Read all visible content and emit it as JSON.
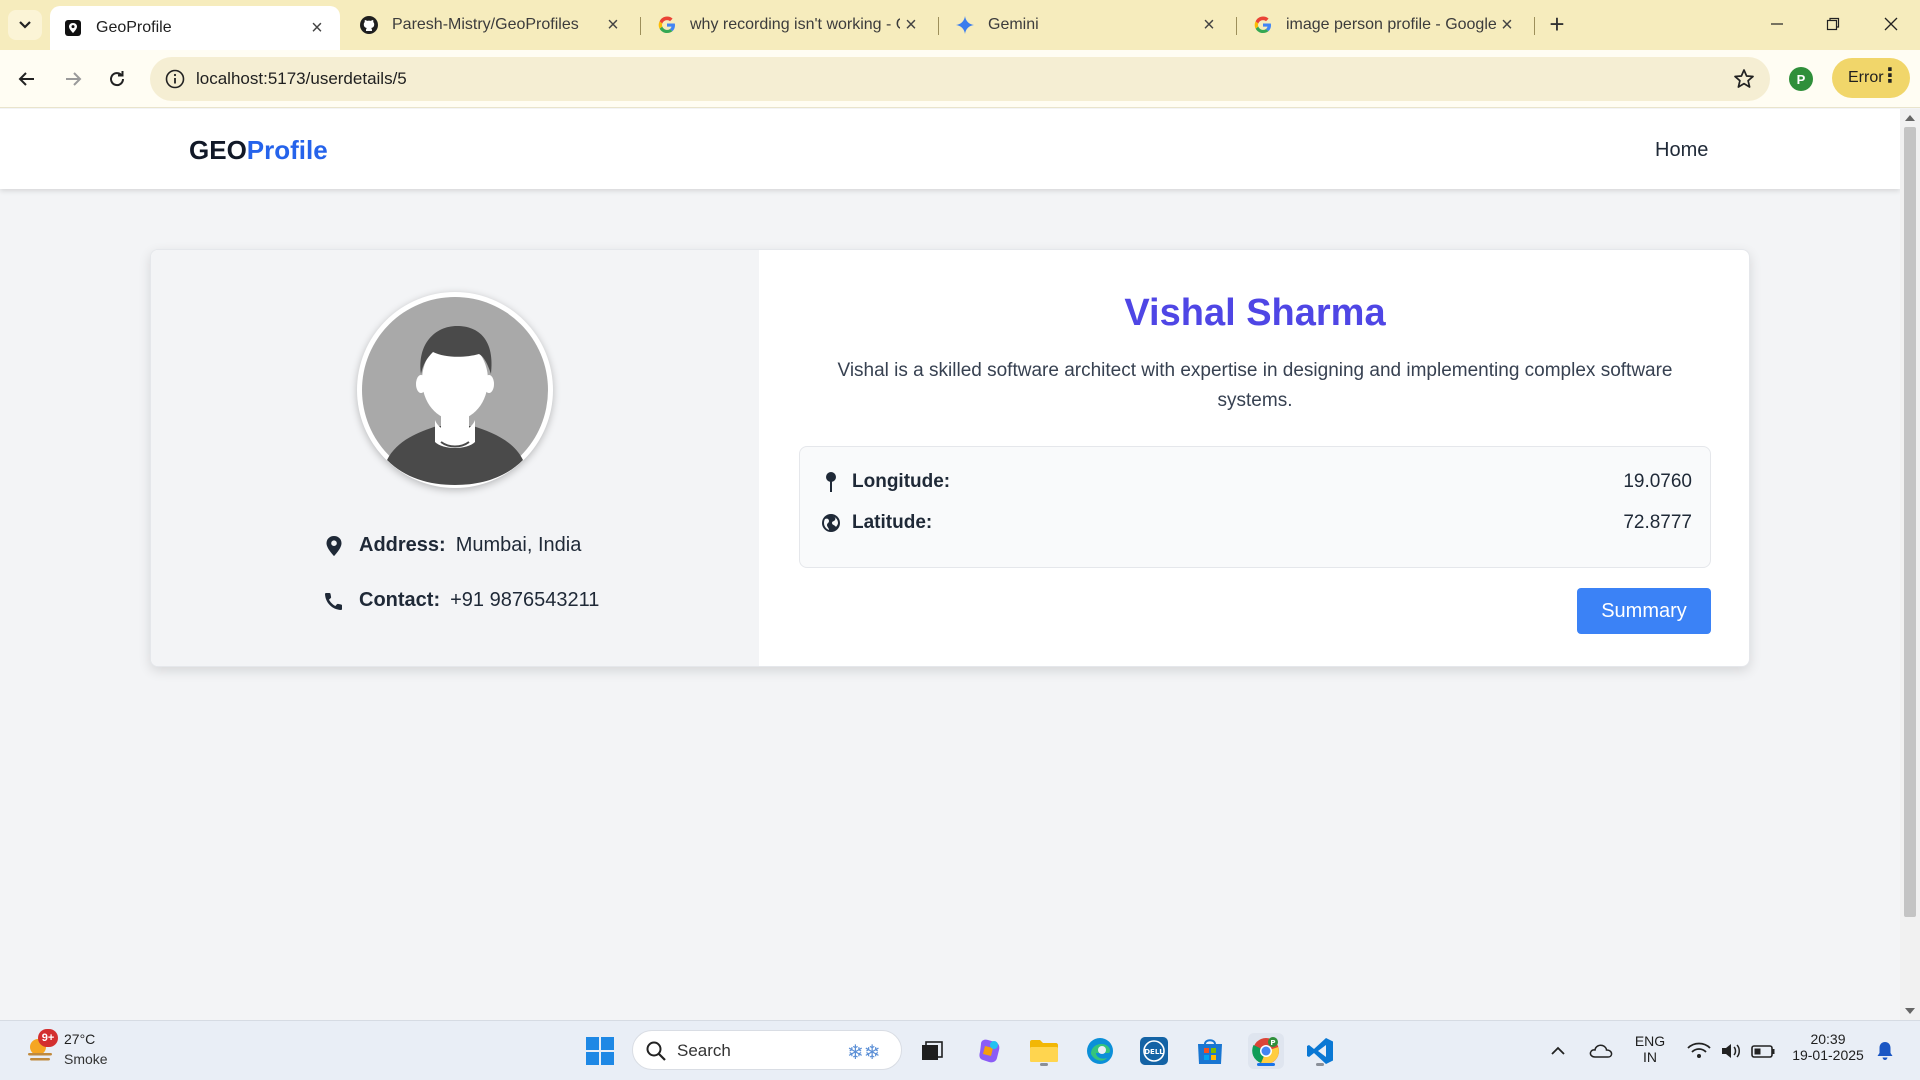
{
  "browser": {
    "tabs": [
      {
        "title": "GeoProfile",
        "favicon": "map-pin-icon",
        "active": true
      },
      {
        "title": "Paresh-Mistry/GeoProfiles",
        "favicon": "github-icon",
        "active": false
      },
      {
        "title": "why recording isn't working - G",
        "favicon": "google-icon",
        "active": false
      },
      {
        "title": "Gemini",
        "favicon": "gemini-icon",
        "active": false
      },
      {
        "title": "image person profile - Google S",
        "favicon": "google-icon",
        "active": false
      }
    ],
    "url": "localhost:5173/userdetails/5",
    "profile_initial": "P",
    "error_label": "Error"
  },
  "app": {
    "brand_geo": "GEO",
    "brand_profile": "Profile",
    "nav_home": "Home"
  },
  "user": {
    "name": "Vishal Sharma",
    "description": "Vishal is a skilled software architect with expertise in designing and implementing complex software systems.",
    "address_label": "Address:",
    "address": "Mumbai, India",
    "contact_label": "Contact:",
    "contact": "+91 9876543211",
    "longitude_label": "Longitude:",
    "longitude": "19.0760",
    "latitude_label": "Latitude:",
    "latitude": "72.8777",
    "summary_button": "Summary"
  },
  "taskbar": {
    "weather_badge": "9+",
    "weather_temp": "27°C",
    "weather_desc": "Smoke",
    "search_label": "Search",
    "lang_line1": "ENG",
    "lang_line2": "IN",
    "time": "20:39",
    "date": "19-01-2025"
  },
  "colors": {
    "accent_indigo": "#4f46e5",
    "accent_blue": "#2563eb",
    "button_blue": "#3b82f6",
    "tabstrip": "#f6ecbd"
  }
}
